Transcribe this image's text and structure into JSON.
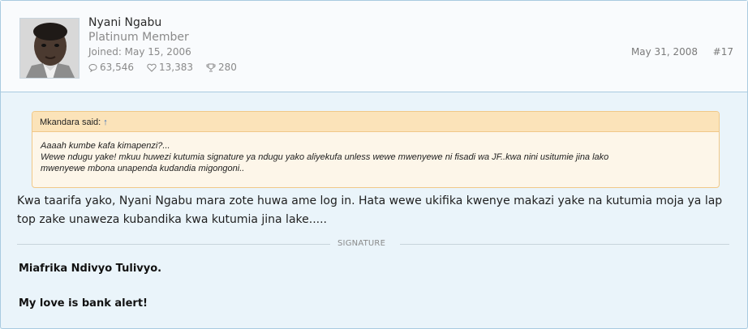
{
  "author": {
    "name": "Nyani Ngabu",
    "title": "Platinum Member",
    "joined": "Joined: May 15, 2006",
    "stats": {
      "messages": "63,546",
      "likes": "13,383",
      "trophies": "280"
    }
  },
  "post": {
    "date": "May 31, 2008",
    "number": "#17"
  },
  "quote": {
    "author_said": "Mkandara said:",
    "arrow": "↑",
    "lines": [
      "Aaaah kumbe kafa kimapenzi?...",
      "Wewe ndugu yake! mkuu huwezi kutumia signature ya ndugu yako aliyekufa unless wewe mwenyewe ni fisadi wa JF..kwa nini usitumie jina lako",
      "mwenyewe mbona unapenda kudandia migongoni.."
    ]
  },
  "message": {
    "line1": "Kwa taarifa yako, Nyani Ngabu mara zote huwa ame log in. Hata wewe ukifika kwenye makazi yake na kutumia moja ya lap",
    "line2": "top zake unaweza kubandika kwa kutumia jina lake....."
  },
  "signature": {
    "label": "SIGNATURE",
    "line1": "Miafrika Ndivyo Tulivyo.",
    "line2": "My love is bank alert!"
  }
}
